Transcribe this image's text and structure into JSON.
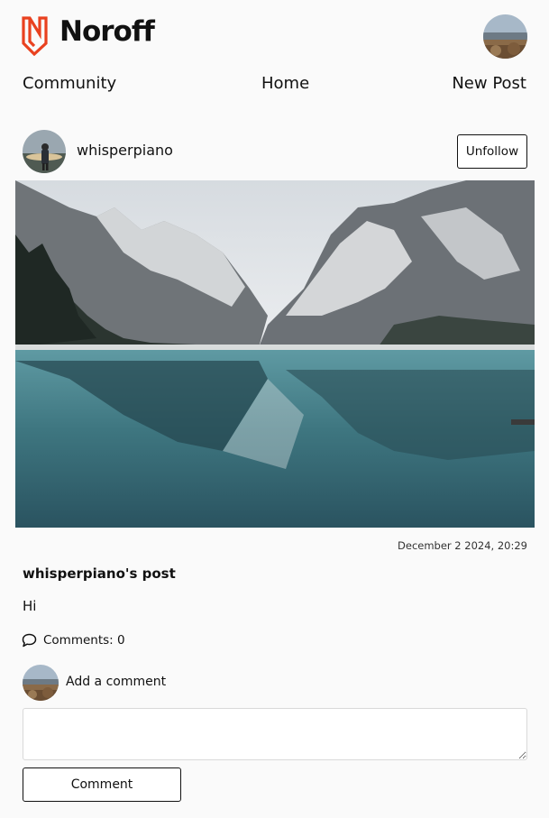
{
  "brand": {
    "name": "Noroff",
    "accent": "#e9411f"
  },
  "nav": {
    "community": "Community",
    "home": "Home",
    "new_post": "New Post"
  },
  "post": {
    "author": "whisperpiano",
    "follow_button": "Unfollow",
    "date": "December 2 2024, 20:29",
    "title": "whisperpiano's post",
    "body": "Hi",
    "comments_label": "Comments: 0"
  },
  "comment_form": {
    "label": "Add a comment",
    "textarea_value": "",
    "submit": "Comment"
  },
  "icons": {
    "comment": "speech-bubble-icon"
  }
}
